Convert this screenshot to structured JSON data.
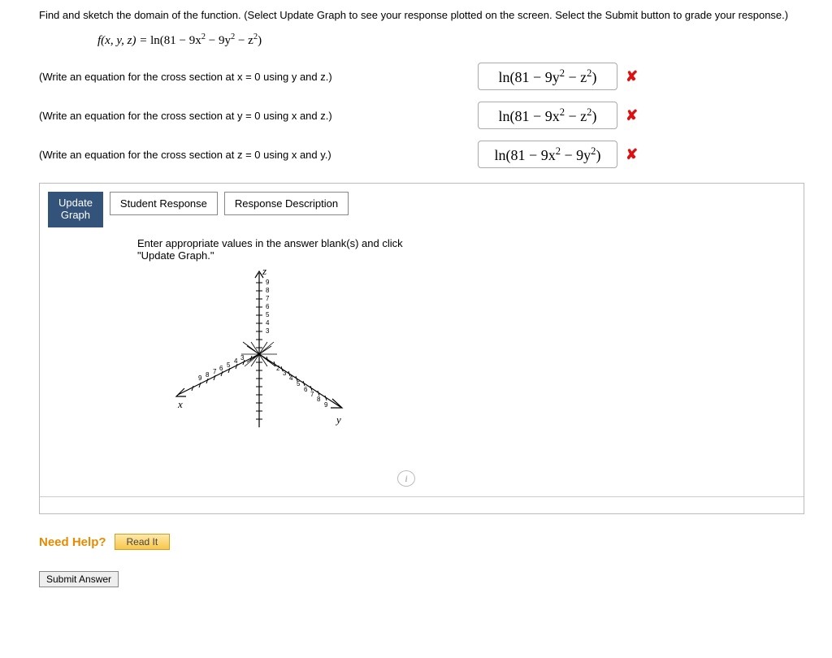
{
  "question": {
    "line1": "Find and sketch the domain of the function. (Select Update Graph to see your response plotted on the screen. Select the Submit button to grade your response.)",
    "fn_prefix": "f(x, y, z) = ",
    "fn_body_html": "ln(81 − 9x<sup>2</sup> − 9y<sup>2</sup> − z<sup>2</sup>)"
  },
  "rows": [
    {
      "prompt": "(Write an equation for the cross section at x = 0 using y and z.)",
      "answer_html": "ln(81 − 9y<sup>2</sup> − z<sup>2</sup>)",
      "mark": "✘"
    },
    {
      "prompt": "(Write an equation for the cross section at y = 0 using x and z.)",
      "answer_html": "ln(81 − 9x<sup>2</sup> − z<sup>2</sup>)",
      "mark": "✘"
    },
    {
      "prompt": "(Write an equation for the cross section at z = 0 using x and y.)",
      "answer_html": "ln(81 − 9x<sup>2</sup> − 9y<sup>2</sup>)",
      "mark": "✘"
    }
  ],
  "tabs": {
    "update_line1": "Update",
    "update_line2": "Graph",
    "student": "Student Response",
    "desc": "Response Description"
  },
  "graph_instructions": "Enter appropriate values in the answer blank(s) and click \"Update Graph.\"",
  "axis_labels": {
    "x": "x",
    "y": "y",
    "z": "z"
  },
  "need_help": "Need Help?",
  "read_it": "Read It",
  "submit": "Submit Answer",
  "info": "i"
}
